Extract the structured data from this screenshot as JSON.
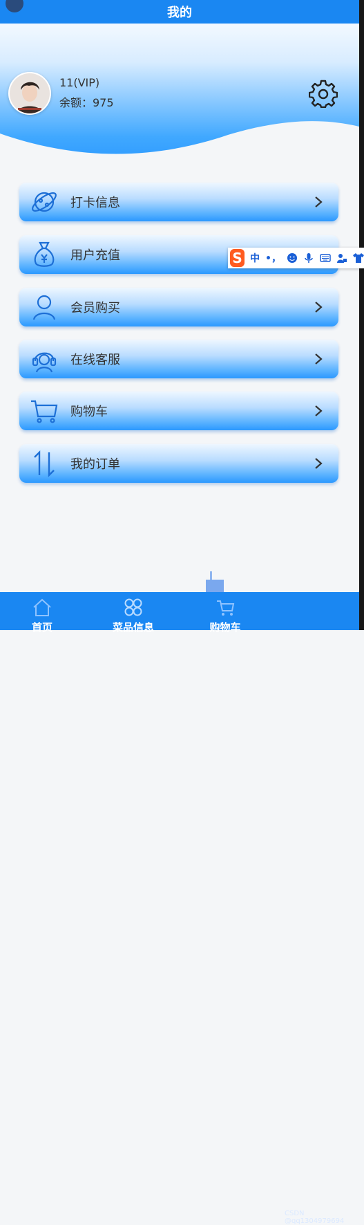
{
  "header": {
    "title": "我的"
  },
  "user": {
    "name": "11(VIP)",
    "balance_label": "余额：975"
  },
  "menu": [
    {
      "label": "打卡信息",
      "icon": "planet-icon"
    },
    {
      "label": "用户充值",
      "icon": "money-bag-icon"
    },
    {
      "label": "会员购买",
      "icon": "user-icon"
    },
    {
      "label": "在线客服",
      "icon": "headset-icon"
    },
    {
      "label": "购物车",
      "icon": "cart-icon"
    },
    {
      "label": "我的订单",
      "icon": "sort-arrows-icon"
    }
  ],
  "ime": {
    "mode_label": "中",
    "punct_label": "•，"
  },
  "tabs": [
    {
      "label": "首页",
      "icon": "home-icon"
    },
    {
      "label": "菜品信息",
      "icon": "grid-icon"
    },
    {
      "label": "购物车",
      "icon": "cart-icon"
    }
  ],
  "watermark": "CSDN @qq1304979694",
  "colors": {
    "primary": "#1a87f2",
    "ime_logo": "#ff5b1f"
  }
}
